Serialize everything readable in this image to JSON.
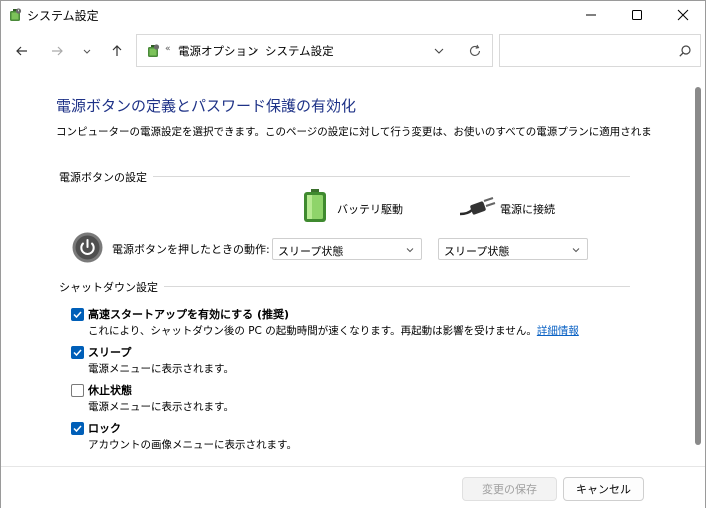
{
  "window": {
    "title": "システム設定",
    "controls": {
      "minimize": "minimize-icon",
      "maximize": "maximize-icon",
      "close": "close-icon"
    }
  },
  "nav": {
    "back": "back-arrow-icon",
    "forward": "forward-arrow-icon",
    "recent": "chevron-down-icon",
    "up": "up-arrow-icon",
    "breadcrumb": [
      "電源オプション",
      "システム設定"
    ],
    "separator_first": "«",
    "separator": "›",
    "search_placeholder": ""
  },
  "page": {
    "title": "電源ボタンの定義とパスワード保護の有効化",
    "description": "コンピューターの電源設定を選択できます。このページの設定に対して行う変更は、お使いのすべての電源プランに適用されま"
  },
  "power_buttons": {
    "section_label": "電源ボタンの設定",
    "battery_label": "バッテリ駆動",
    "plugged_label": "電源に接続",
    "row_label": "電源ボタンを押したときの動作:",
    "battery_value": "スリープ状態",
    "plugged_value": "スリープ状態"
  },
  "shutdown": {
    "section_label": "シャットダウン設定",
    "items": [
      {
        "label": "高速スタートアップを有効にする (推奨)",
        "desc": "これにより、シャットダウン後の PC の起動時間が速くなります。再起動は影響を受けません。",
        "link": "詳細情報",
        "checked": true
      },
      {
        "label": "スリープ",
        "desc": "電源メニューに表示されます。",
        "checked": true
      },
      {
        "label": "休止状態",
        "desc": "電源メニューに表示されます。",
        "checked": false
      },
      {
        "label": "ロック",
        "desc": "アカウントの画像メニューに表示されます。",
        "checked": true
      }
    ]
  },
  "footer": {
    "save_label": "変更の保存",
    "cancel_label": "キャンセル"
  },
  "colors": {
    "title_blue": "#1e3287",
    "accent": "#005fb8",
    "link": "#0b62c4"
  }
}
